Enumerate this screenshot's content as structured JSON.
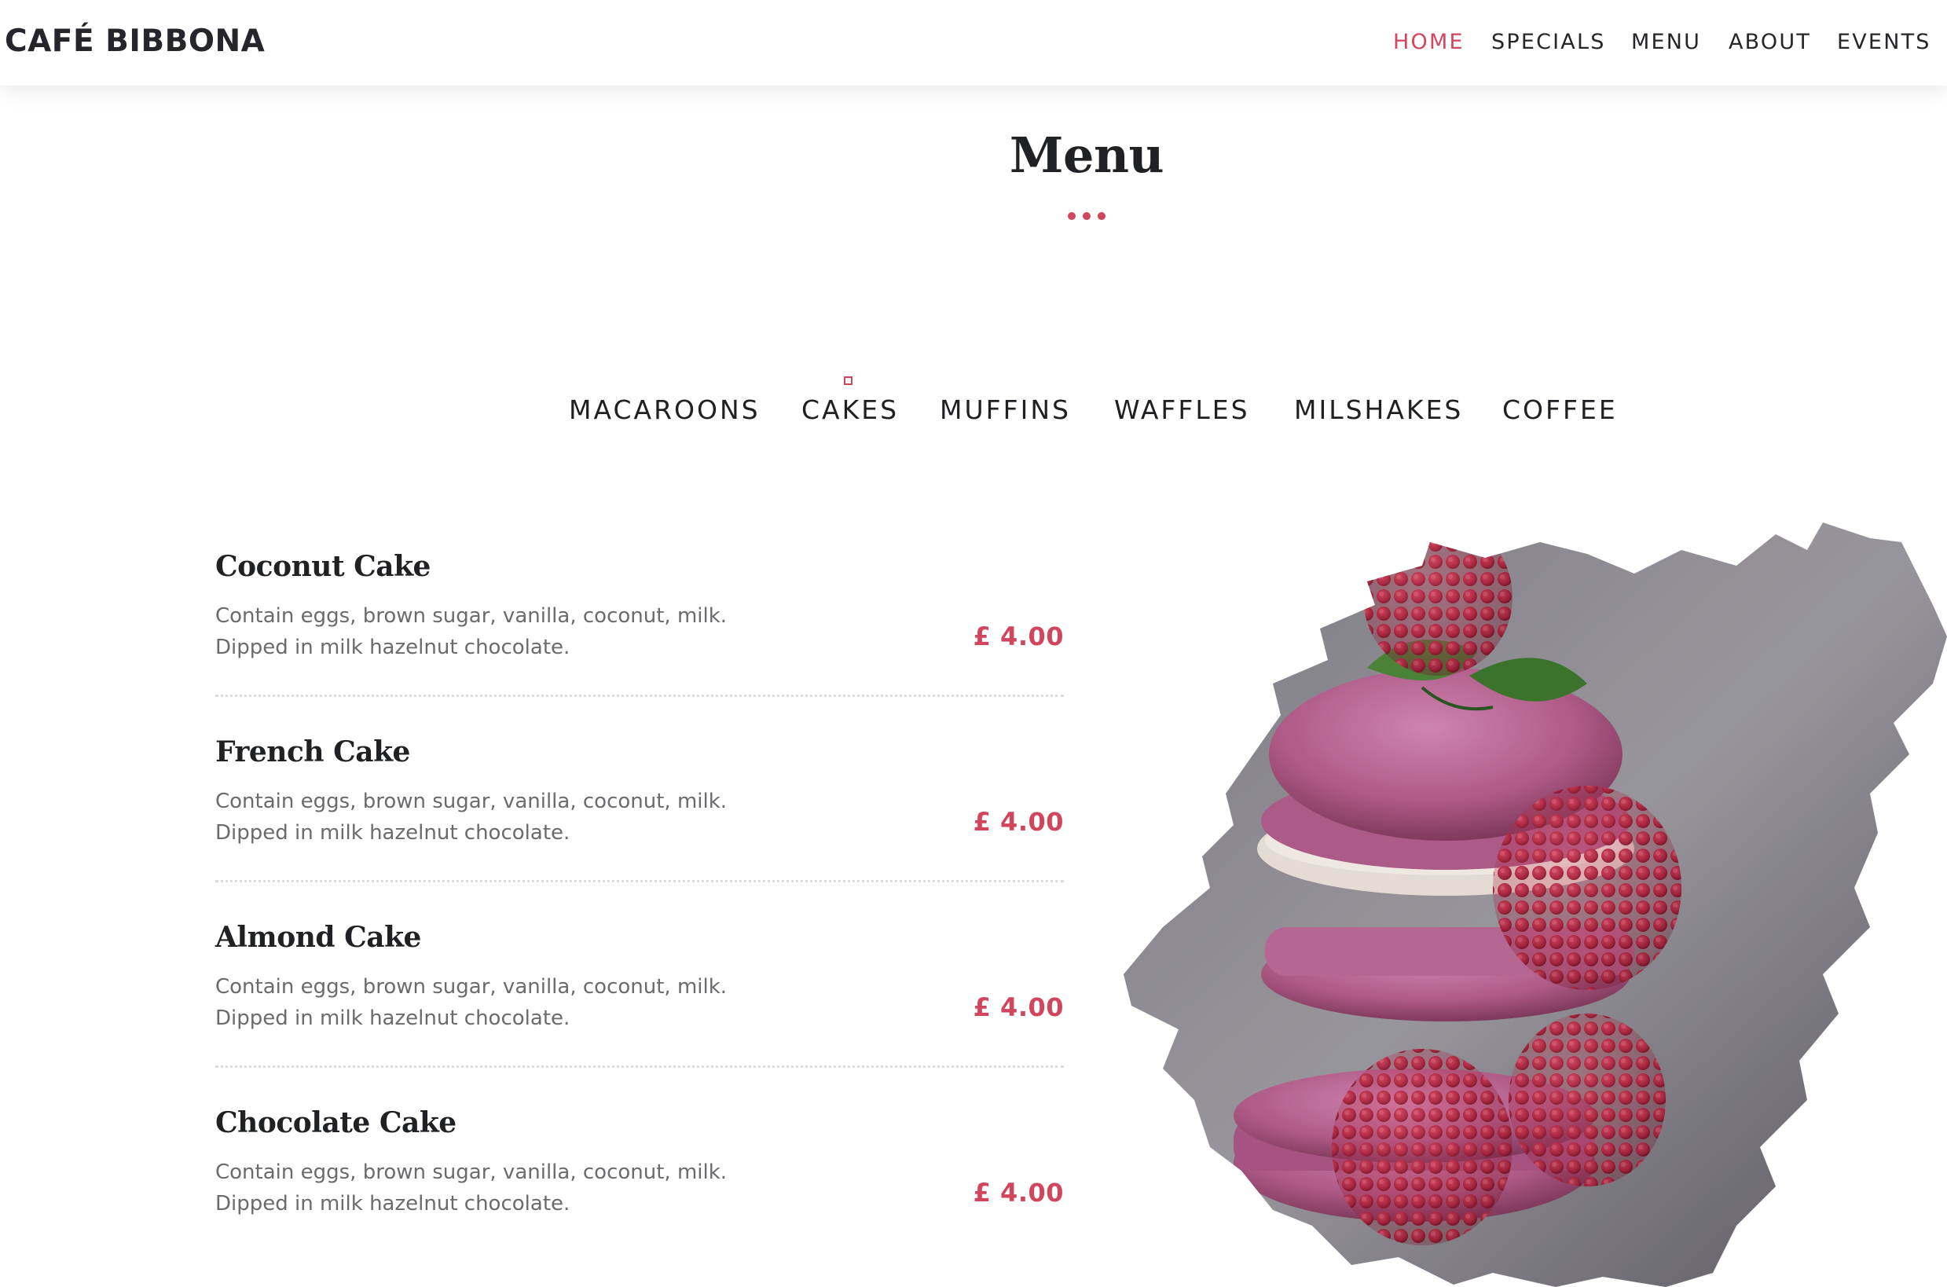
{
  "header": {
    "brand": "CAFÉ BIBBONA",
    "nav": [
      {
        "label": "HOME",
        "active": true
      },
      {
        "label": "SPECIALS",
        "active": false
      },
      {
        "label": "MENU",
        "active": false
      },
      {
        "label": "ABOUT",
        "active": false
      },
      {
        "label": "EVENTS",
        "active": false
      }
    ]
  },
  "section": {
    "title": "Menu"
  },
  "tabs": [
    "MACAROONS",
    "CAKES",
    "MUFFINS",
    "WAFFLES",
    "MILSHAKES",
    "COFFEE"
  ],
  "items": [
    {
      "name": "Coconut Cake",
      "desc_line1": "Contain eggs, brown sugar, vanilla, coconut, milk.",
      "desc_line2": "Dipped in milk hazelnut chocolate.",
      "price": "£ 4.00"
    },
    {
      "name": "French Cake",
      "desc_line1": "Contain eggs, brown sugar, vanilla, coconut, milk.",
      "desc_line2": "Dipped in milk hazelnut chocolate.",
      "price": "£ 4.00"
    },
    {
      "name": "Almond Cake",
      "desc_line1": "Contain eggs, brown sugar, vanilla, coconut, milk.",
      "desc_line2": "Dipped in milk hazelnut chocolate.",
      "price": "£ 4.00"
    },
    {
      "name": "Chocolate Cake",
      "desc_line1": "Contain eggs, brown sugar, vanilla, coconut, milk.",
      "desc_line2": "Dipped in milk hazelnut chocolate.",
      "price": "£ 4.00"
    }
  ],
  "colors": {
    "accent": "#d2465d",
    "text": "#1f2125",
    "muted": "#6a6a70"
  },
  "image": {
    "subject": "raspberry-macaron-stack"
  }
}
